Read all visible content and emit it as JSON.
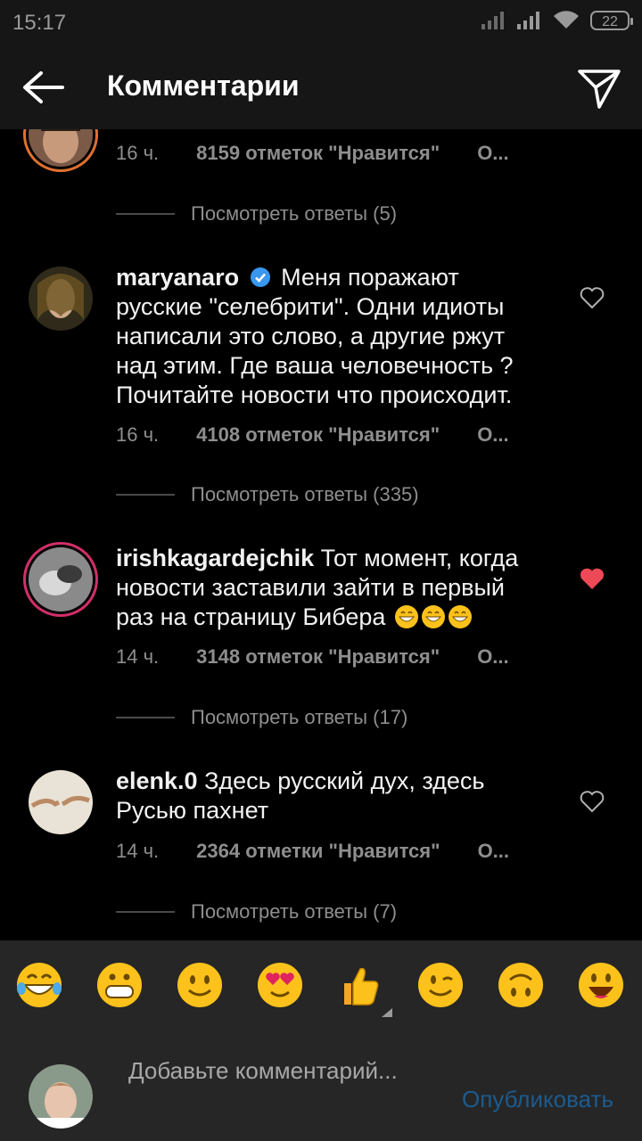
{
  "status_bar": {
    "time": "15:17",
    "battery": "22"
  },
  "header": {
    "title": "Комментарии",
    "back_icon": "arrow-left-icon",
    "share_icon": "send-icon"
  },
  "comments": [
    {
      "username": "",
      "text": "",
      "time": "16 ч.",
      "likes": "8159 отметок \"Нравится\"",
      "reply": "О...",
      "liked": true,
      "view_replies": "Посмотреть ответы (5)"
    },
    {
      "username": "maryanaro",
      "verified": true,
      "text": "Меня поражают русские \"селебрити\". Одни идиоты написали это слово, а другие ржут над этим. Где ваша человечность ? Почитайте новости что происходит.",
      "time": "16 ч.",
      "likes": "4108 отметок \"Нравится\"",
      "reply": "О...",
      "liked": false,
      "view_replies": "Посмотреть ответы (335)"
    },
    {
      "username": "irishkagardejchik",
      "text": "Тот момент, когда новости заставили зайти в первый раз  на страницу Бибера",
      "time": "14 ч.",
      "likes": "3148 отметок \"Нравится\"",
      "reply": "О...",
      "liked": true,
      "view_replies": "Посмотреть ответы (17)"
    },
    {
      "username": "elenk.0",
      "text": "Здесь русский дух, здесь Русью пахнет",
      "time": "14 ч.",
      "likes": "2364 отметки \"Нравится\"",
      "reply": "О...",
      "liked": false,
      "view_replies": "Посмотреть ответы (7)"
    }
  ],
  "emoji_bar": [
    "laughing-tears",
    "grinning",
    "smiling",
    "heart-eyes",
    "thumbs-up",
    "winking",
    "upside-down",
    "smiling-open"
  ],
  "composer": {
    "placeholder": "Добавьте комментарий...",
    "publish": "Опубликовать"
  },
  "colors": {
    "liked_heart": "#ed4956",
    "publish": "#1c5b8f",
    "background": "#000000",
    "bar": "#262626"
  }
}
